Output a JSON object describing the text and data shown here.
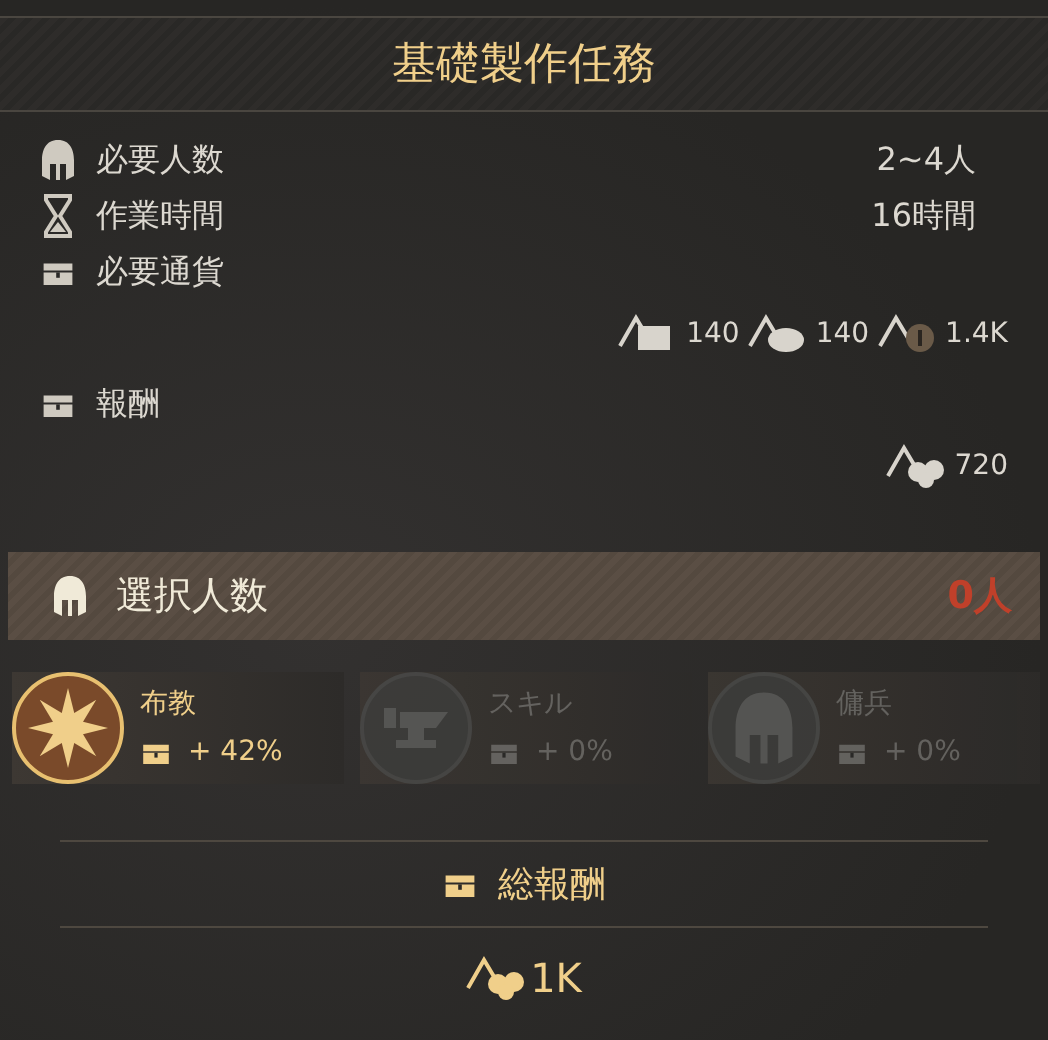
{
  "title": "基礎製作任務",
  "info_rows": [
    {
      "kind": "helmet",
      "label": "必要人数",
      "value": "2~4人"
    },
    {
      "kind": "hourglass",
      "label": "作業時間",
      "value": "16時間"
    }
  ],
  "cost": {
    "label": "必要通貨",
    "items": [
      {
        "kind": "crate",
        "amount": "140"
      },
      {
        "kind": "sack",
        "amount": "140"
      },
      {
        "kind": "coin",
        "amount": "1.4K"
      }
    ]
  },
  "reward": {
    "label": "報酬",
    "items": [
      {
        "kind": "pile",
        "amount": "720"
      }
    ]
  },
  "selection": {
    "label": "選択人数",
    "count": "0人"
  },
  "bonuses": [
    {
      "kind": "star",
      "name": "布教",
      "value": "+ 42%",
      "active": true
    },
    {
      "kind": "anvil",
      "name": "スキル",
      "value": "+ 0%",
      "active": false
    },
    {
      "kind": "helmet",
      "name": "傭兵",
      "value": "+ 0%",
      "active": false
    }
  ],
  "total": {
    "label": "総報酬",
    "items": [
      {
        "kind": "pile",
        "amount": "1K"
      }
    ]
  }
}
